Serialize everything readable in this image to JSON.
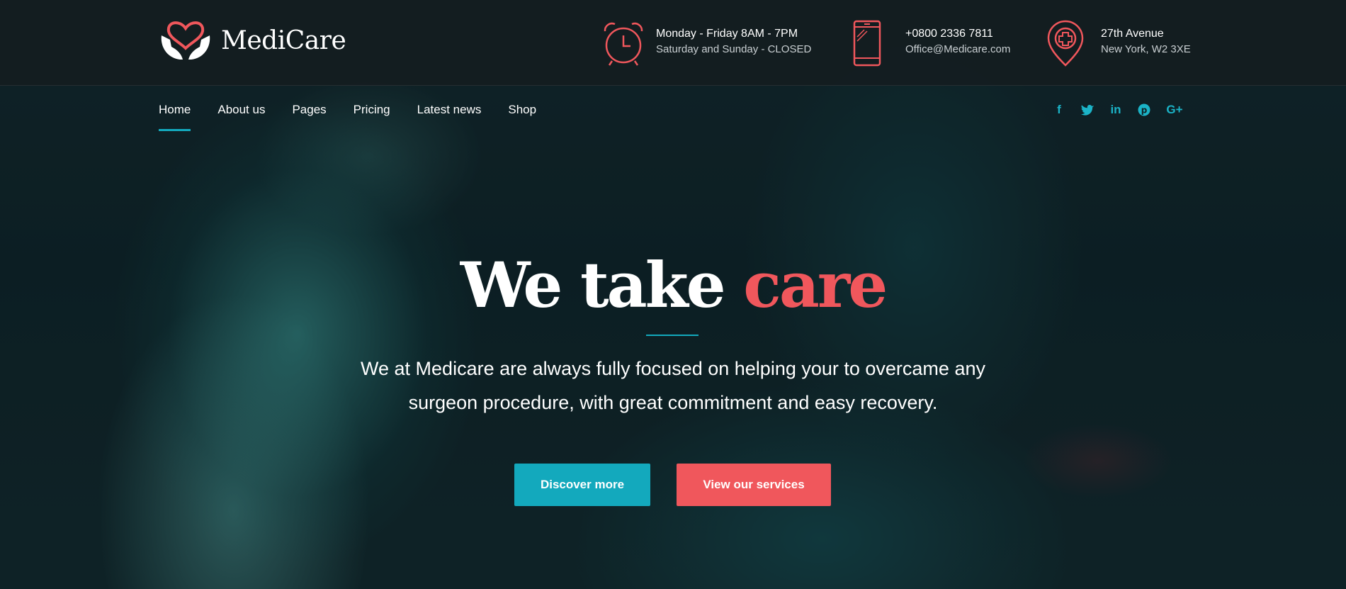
{
  "brand": {
    "name": "MediCare",
    "accent": "#f0575c",
    "primary": "#13a9bd"
  },
  "contact": {
    "hours": {
      "line1": "Monday - Friday 8AM - 7PM",
      "line2": "Saturday and Sunday - CLOSED",
      "icon": "alarm-clock-icon"
    },
    "phone": {
      "line1": "+0800 2336 7811",
      "line2": "Office@Medicare.com",
      "icon": "smartphone-icon"
    },
    "address": {
      "line1": "27th Avenue",
      "line2": "New York, W2 3XE",
      "icon": "medical-location-pin-icon"
    }
  },
  "nav": {
    "items": [
      {
        "label": "Home",
        "active": true
      },
      {
        "label": "About us"
      },
      {
        "label": "Pages"
      },
      {
        "label": "Pricing"
      },
      {
        "label": "Latest news"
      },
      {
        "label": "Shop"
      }
    ]
  },
  "social": {
    "facebook": "f",
    "twitter": "t",
    "linkedin": "in",
    "pinterest": "p",
    "googleplus": "G+"
  },
  "hero": {
    "title_main": "We take ",
    "title_accent": "care",
    "text_line1": "We at Medicare are always fully focused on helping your to overcame any",
    "text_line2": "surgeon procedure, with great commitment and easy recovery.",
    "primary_button": "Discover more",
    "secondary_button": "View our services"
  }
}
